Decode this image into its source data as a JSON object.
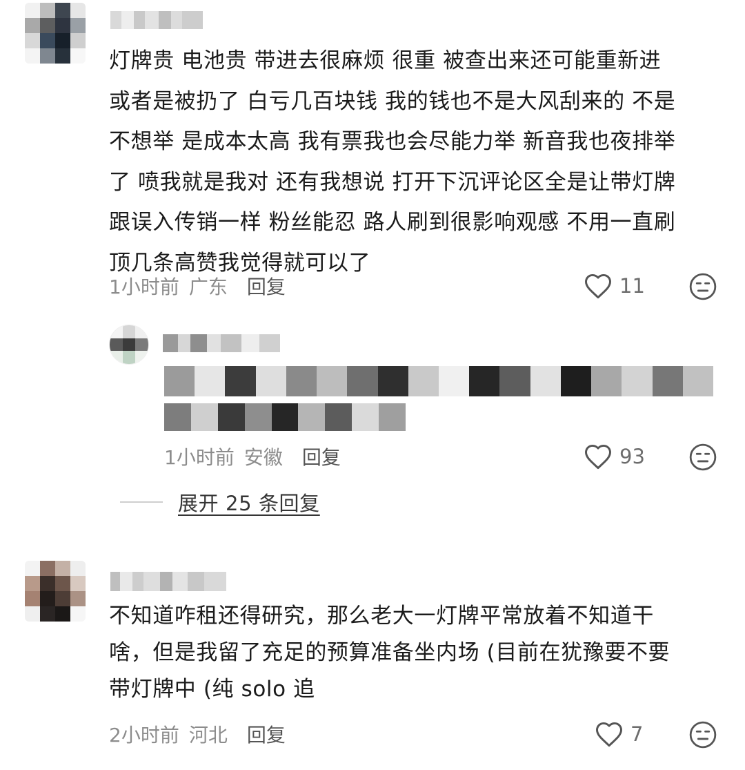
{
  "comments": [
    {
      "lines": [
        "灯牌贵 电池贵 带进去很麻烦 很重 被查出来还可能重新进",
        "或者是被扔了 白亏几百块钱 我的钱也不是大风刮来的 不是",
        "不想举 是成本太高 我有票我也会尽能力举 新音我也夜排举",
        "了 喷我就是我对 还有我想说 打开下沉评论区全是让带灯牌",
        "跟误入传销一样 粉丝能忍 路人刷到很影响观感 不用一直刷",
        "顶几条高赞我觉得就可以了"
      ],
      "time": "1小时前",
      "location": "广东",
      "reply_label": "回复",
      "likes": "11"
    },
    {
      "lines": [
        "不知道咋租还得研究，那么老大一灯牌平常放着不知道干",
        "啥，但是我留了充足的预算准备坐内场 (目前在犹豫要不要",
        "带灯牌中 (纯 solo 追"
      ],
      "time": "2小时前",
      "location": "河北",
      "reply_label": "回复",
      "likes": "7"
    }
  ],
  "reply": {
    "time": "1小时前",
    "location": "安徽",
    "reply_label": "回复",
    "likes": "93"
  },
  "expand_label": "展开 25 条回复",
  "icons": {
    "like": "heart-outline-icon",
    "dislike": "meh-face-icon"
  },
  "colors": {
    "text": "#1b1b1b",
    "meta": "#8c8c8c",
    "icon": "#555555"
  }
}
